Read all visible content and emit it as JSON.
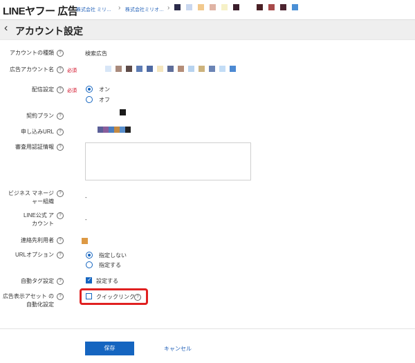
{
  "header": {
    "logo": "LINEヤフー 広告",
    "breadcrumb": [
      "株式会社 ミリ…",
      "株式会社ミリオ…"
    ],
    "masked_colors": [
      "#2b2b4a",
      "#c9d7ef",
      "#f2c98d",
      "#e0b4a5",
      "#f6f1c7",
      "#3b1e2b",
      "#ffffff",
      "#4a2025",
      "#a84a4a",
      "#4c2430",
      "#4a8fd6"
    ]
  },
  "page": {
    "title": "アカウント設定"
  },
  "form": {
    "account_type": {
      "label": "アカウントの種類",
      "value": "検索広告"
    },
    "account_name": {
      "label": "広告アカウント名",
      "required": "必須",
      "masked_colors": [
        "#d8e6f7",
        "#a98a7c",
        "#5e4b48",
        "#5e7db5",
        "#4f6aa3",
        "#f4e5be",
        "#5f6e9a",
        "#b48d78",
        "#b7d3ef",
        "#cdb37d",
        "#6b84b5",
        "#c3ddf6",
        "#4d8ad3"
      ]
    },
    "delivery": {
      "label": "配信設定",
      "required": "必須",
      "options": [
        "オン",
        "オフ"
      ]
    },
    "plan": {
      "label": "契約プラン",
      "masked_colors": [
        "#1a1a1a"
      ]
    },
    "url": {
      "label": "申し込みURL",
      "masked_colors": [
        "#5b5f98",
        "#8a5d9b",
        "#4b7ec0",
        "#c48a43",
        "#5a8fcb",
        "#222222"
      ]
    },
    "review": {
      "label": "審査用認証情報"
    },
    "business": {
      "label": "ビジネス マネージャー組織",
      "value": "-"
    },
    "line": {
      "label": "LINE公式 アカウント",
      "value": "-"
    },
    "contact": {
      "label": "連絡先利用者",
      "masked_colors": [
        "#dd9944"
      ]
    },
    "url_option": {
      "label": "URLオプション",
      "options": [
        "指定しない",
        "指定する"
      ]
    },
    "auto_tag": {
      "label": "自動タグ設定",
      "option": "設定する"
    },
    "asset": {
      "label": "広告表示アセット の自動化設定",
      "option": "クイックリンク"
    }
  },
  "actions": {
    "save": "保存",
    "cancel": "キャンセル"
  },
  "colors": {
    "accent": "#1565c0",
    "required": "#d0021b",
    "highlight": "#e02020"
  }
}
